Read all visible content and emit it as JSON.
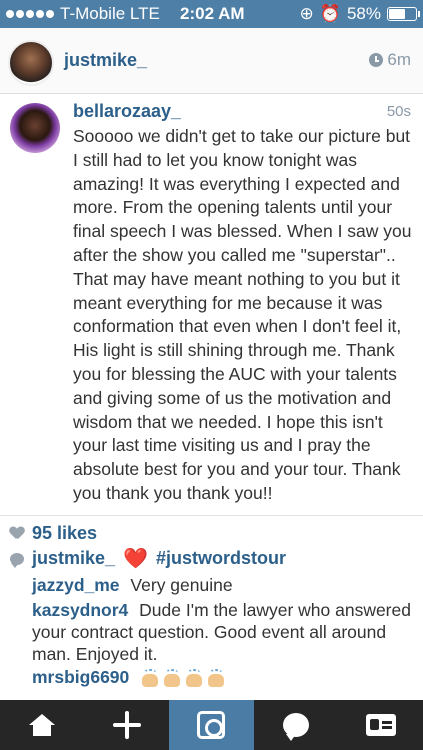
{
  "status_bar": {
    "signal_dots": 5,
    "carrier": "T-Mobile",
    "network": "LTE",
    "time": "2:02 AM",
    "battery": "58%",
    "battery_level": 0.58
  },
  "post": {
    "username": "justmike_",
    "time": "6m"
  },
  "comment": {
    "username": "bellarozaay_",
    "time": "50s",
    "text": "Sooooo we didn't get to take our picture but I still had to let you know tonight was amazing! It was everything I expected and more. From the opening talents until your final speech I was blessed. When I saw you after the show you called me \"superstar\".. That may have meant nothing to you but it meant everything for me because it was conformation that even when I don't feel it, His light is still shining through me. Thank you for blessing the AUC with your talents and giving some of us the motivation and wisdom that we needed. I hope this isn't your last time visiting us and I pray the absolute best for you and your tour. Thank you thank you thank you!!"
  },
  "likes": "95 likes",
  "caption": {
    "username": "justmike_",
    "emoji": "❤️",
    "hashtag": "#justwordstour"
  },
  "comments": [
    {
      "username": "jazzyd_me",
      "text": "Very genuine"
    },
    {
      "username": "kazsydnor4",
      "text": "Dude I'm the lawyer who answered your contract question. Good event all around man. Enjoyed it."
    },
    {
      "username": "mrsbig6690",
      "text": ""
    }
  ],
  "tabs": [
    {
      "name": "home-icon",
      "active": false
    },
    {
      "name": "explore-icon",
      "active": false
    },
    {
      "name": "camera-icon",
      "active": true
    },
    {
      "name": "activity-icon",
      "active": false
    },
    {
      "name": "profile-icon",
      "active": false
    }
  ],
  "colors": {
    "status_bar": "#4e7fa6",
    "username": "#2c5f8a",
    "tab_bar": "#262626",
    "tab_active": "#4a7ca6"
  }
}
